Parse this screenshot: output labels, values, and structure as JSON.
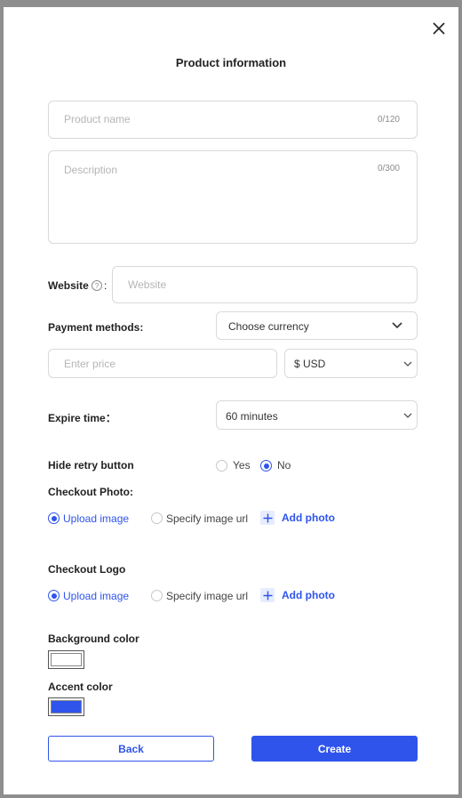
{
  "modal": {
    "title": "Product information"
  },
  "product_name": {
    "placeholder": "Product name",
    "counter": "0/120"
  },
  "description": {
    "placeholder": "Description",
    "counter": "0/300"
  },
  "website": {
    "label": "Website",
    "colon": ":",
    "placeholder": "Website"
  },
  "payment": {
    "label": "Payment methods:",
    "currency_select": "Choose currency",
    "price_placeholder": "Enter price",
    "currency_value": "$ USD"
  },
  "expire": {
    "label": "Expire time：",
    "value": "60 minutes"
  },
  "hide_retry": {
    "label": "Hide retry button",
    "yes": "Yes",
    "no": "No",
    "selected": "No"
  },
  "checkout_photo": {
    "label": "Checkout Photo:",
    "upload_label": "Upload image",
    "url_label": "Specify image url",
    "add_label": "Add photo",
    "selected": "Upload image"
  },
  "checkout_logo": {
    "label": "Checkout Logo",
    "upload_label": "Upload image",
    "url_label": "Specify image url",
    "add_label": "Add photo",
    "selected": "Upload image"
  },
  "colors": {
    "background_label": "Background color",
    "background_value": "#ffffff",
    "accent_label": "Accent color",
    "accent_value": "#2f54eb"
  },
  "actions": {
    "back": "Back",
    "create": "Create"
  },
  "icons": {
    "close": "close-icon",
    "help": "question-circle-icon",
    "chevron": "chevron-down-icon",
    "plus": "plus-icon"
  }
}
